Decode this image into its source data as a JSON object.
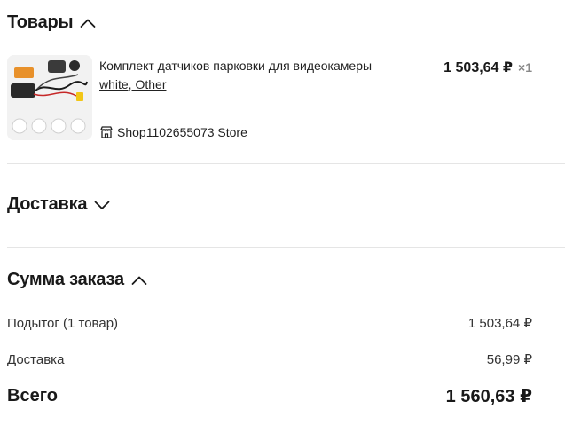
{
  "products_section": {
    "title": "Товары",
    "item": {
      "name": "Комплект датчиков парковки для видеокамеры",
      "variant": "white, Other",
      "store": "Shop1102655073 Store",
      "price": "1 503,64 ₽",
      "quantity": "×1"
    }
  },
  "delivery_section": {
    "title": "Доставка"
  },
  "summary_section": {
    "title": "Сумма заказа",
    "subtotal_label": "Подытог (1 товар)",
    "subtotal_value": "1 503,64 ₽",
    "delivery_label": "Доставка",
    "delivery_value": "56,99 ₽",
    "total_label": "Всего",
    "total_value": "1 560,63 ₽"
  },
  "icons": {
    "products_toggle": "chevron-up-icon",
    "delivery_toggle": "chevron-down-icon",
    "summary_toggle": "chevron-up-icon",
    "store": "store-icon"
  }
}
